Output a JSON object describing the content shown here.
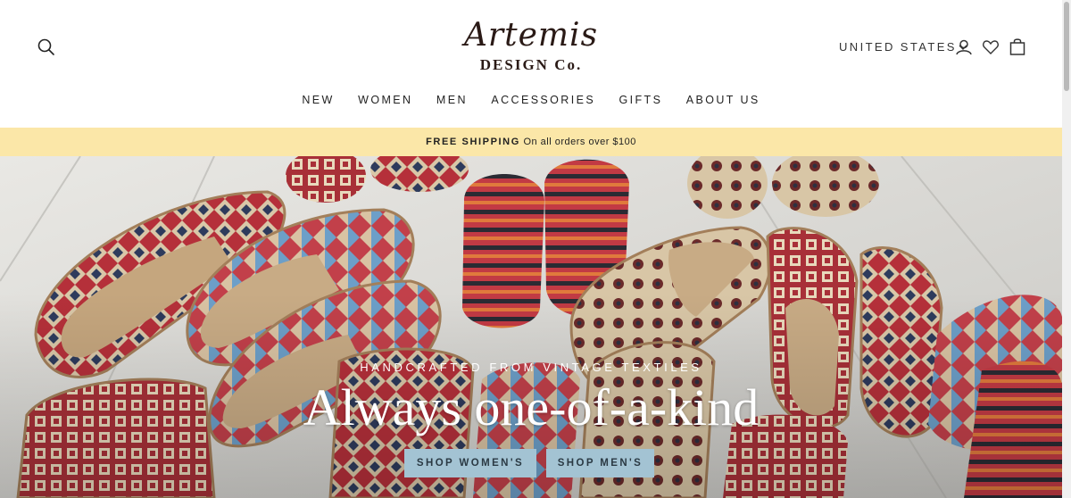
{
  "brand": {
    "logo_main": "Artemis",
    "logo_sub": "DESIGN Co."
  },
  "header": {
    "country": "UNITED STATES",
    "icons": [
      "search-icon",
      "user-icon",
      "heart-icon",
      "bag-icon"
    ]
  },
  "nav": {
    "items": [
      {
        "label": "NEW"
      },
      {
        "label": "WOMEN"
      },
      {
        "label": "MEN"
      },
      {
        "label": "ACCESSORIES"
      },
      {
        "label": "GIFTS"
      },
      {
        "label": "ABOUT US"
      }
    ]
  },
  "banner": {
    "bold": "FREE SHIPPING",
    "text": "On all orders over $100"
  },
  "hero": {
    "kicker": "HANDCRAFTED FROM VINTAGE TEXTILES",
    "title": "Always one-of-a-kind",
    "buttons": [
      {
        "label": "SHOP WOMEN'S"
      },
      {
        "label": "SHOP MEN'S"
      }
    ]
  },
  "colors": {
    "banner_bg": "#fbe7a8",
    "button_bg": "#a3c3d3",
    "logo": "#2a1a16"
  }
}
